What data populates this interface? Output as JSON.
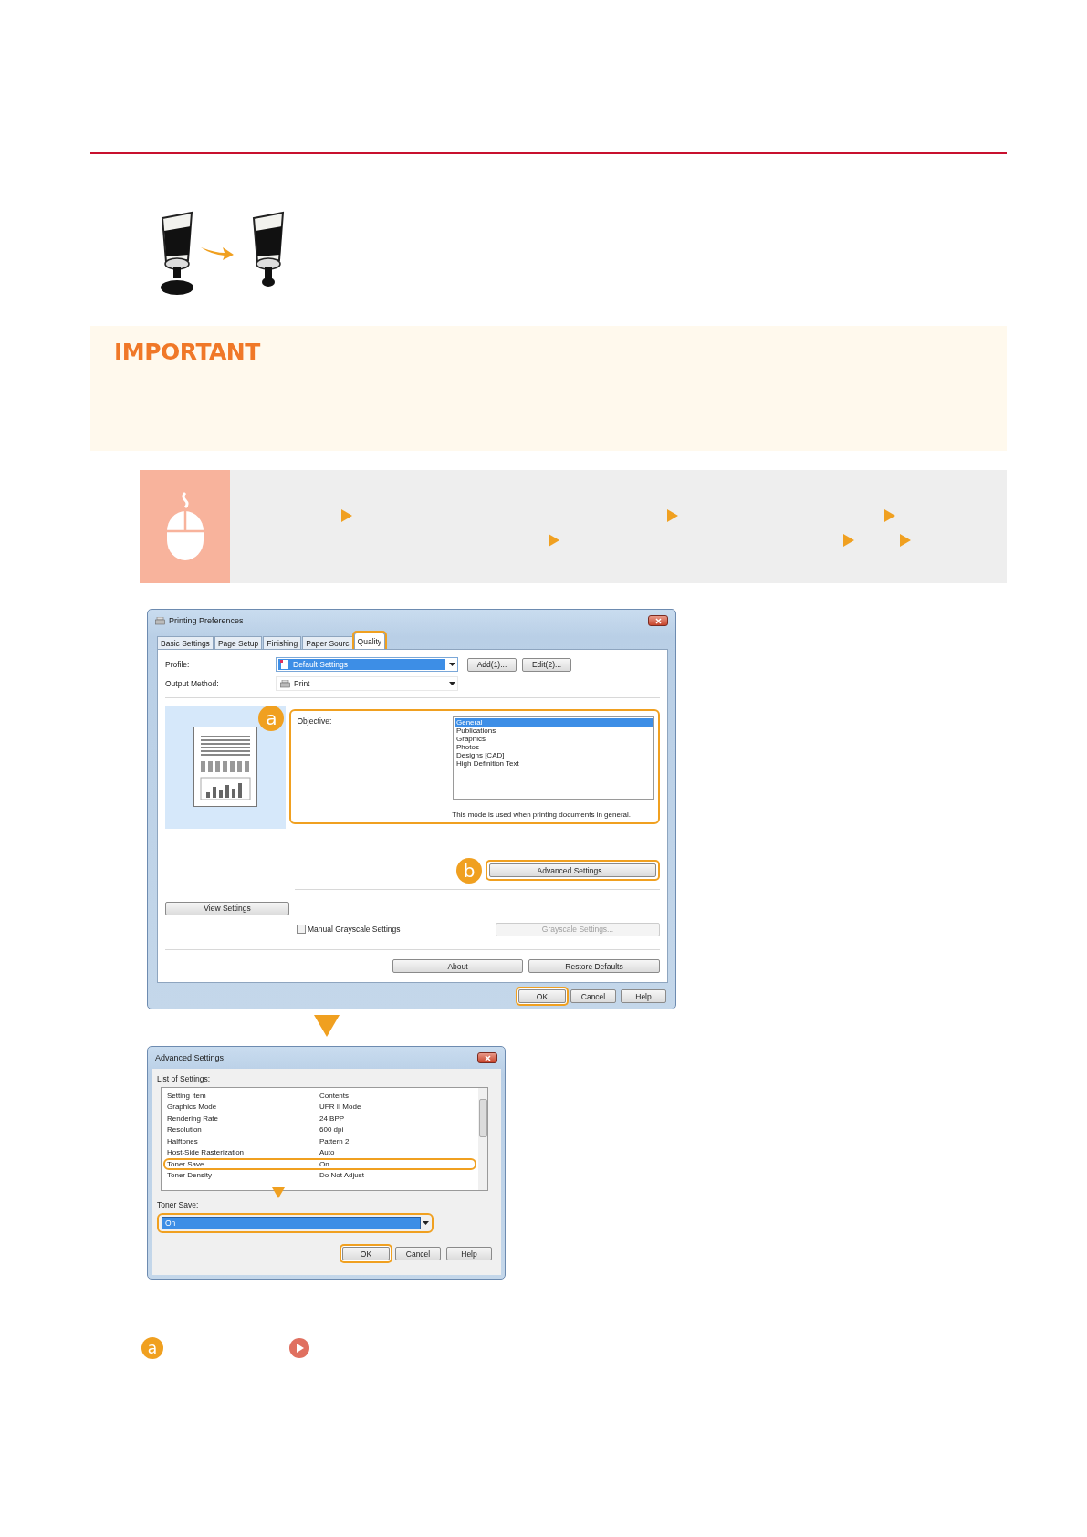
{
  "important": {
    "title": "IMPORTANT"
  },
  "printing_preferences": {
    "title": "Printing Preferences",
    "tabs": [
      {
        "label": "Basic Settings",
        "selected": false
      },
      {
        "label": "Page Setup",
        "selected": false
      },
      {
        "label": "Finishing",
        "selected": false
      },
      {
        "label": "Paper Sourc",
        "selected": false
      },
      {
        "label": "Quality",
        "selected": true
      }
    ],
    "profile": {
      "label": "Profile:",
      "value": "Default Settings"
    },
    "profile_buttons": [
      "Add(1)...",
      "Edit(2)..."
    ],
    "output_method": {
      "label": "Output Method:",
      "value": "Print"
    },
    "objective": {
      "badge": "a",
      "label": "Objective:",
      "options": [
        {
          "label": "General",
          "selected": true
        },
        {
          "label": "Publications",
          "selected": false
        },
        {
          "label": "Graphics",
          "selected": false
        },
        {
          "label": "Photos",
          "selected": false
        },
        {
          "label": "Designs [CAD]",
          "selected": false
        },
        {
          "label": "High Definition Text",
          "selected": false
        }
      ],
      "description": "This mode is used when printing documents in general."
    },
    "advanced": {
      "badge": "b",
      "button": "Advanced Settings..."
    },
    "view_settings": "View Settings",
    "manual_grayscale": {
      "label": "Manual Grayscale Settings",
      "checked": false
    },
    "grayscale_button": {
      "label": "Grayscale Settings...",
      "disabled": true
    },
    "extra_buttons": [
      "About",
      "Restore Defaults"
    ],
    "buttons": [
      {
        "label": "OK",
        "highlighted": true
      },
      {
        "label": "Cancel",
        "highlighted": false
      },
      {
        "label": "Help",
        "highlighted": false
      }
    ]
  },
  "advanced_settings": {
    "title": "Advanced Settings",
    "list_label": "List of Settings:",
    "columns": [
      "Setting Item",
      "Contents"
    ],
    "rows": [
      {
        "item": "Graphics Mode",
        "contents": "UFR II Mode",
        "highlighted": false
      },
      {
        "item": "Rendering Rate",
        "contents": "24 BPP",
        "highlighted": false
      },
      {
        "item": "Resolution",
        "contents": "600 dpi",
        "highlighted": false
      },
      {
        "item": "Halftones",
        "contents": "Pattern 2",
        "highlighted": false
      },
      {
        "item": "Host-Side Rasterization",
        "contents": "Auto",
        "highlighted": false
      },
      {
        "item": "Toner Save",
        "contents": "On",
        "highlighted": true
      },
      {
        "item": "Toner Density",
        "contents": "Do Not Adjust",
        "highlighted": false
      }
    ],
    "field_label": "Toner Save:",
    "field_value": "On",
    "buttons": [
      {
        "label": "OK",
        "highlighted": true
      },
      {
        "label": "Cancel",
        "highlighted": false
      },
      {
        "label": "Help",
        "highlighted": false
      }
    ]
  },
  "legend": {
    "badge": "a"
  }
}
